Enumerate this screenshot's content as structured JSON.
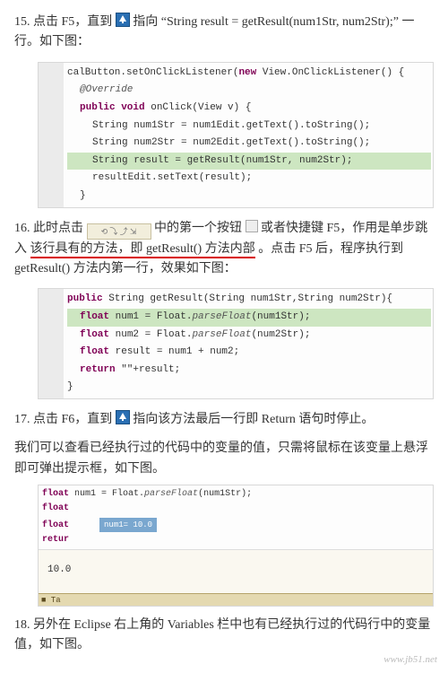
{
  "items": {
    "s15": {
      "num": "15.",
      "pre": "点击 F5，直到",
      "post": "指向 “String result = getResult(num1Str, num2Str);” 一行。如下图："
    },
    "code1": {
      "l1a": "calButton.setOnClickListener(",
      "l1b": "new",
      "l1c": " View.OnClickListener() {",
      "l2": "@Override",
      "l3a": "public void",
      "l3b": " onClick(View v) {",
      "l4": "String num1Str = num1Edit.getText().toString();",
      "l5": "String num2Str = num2Edit.getText().toString();",
      "l6": "String result = getResult(num1Str, num2Str);",
      "l7": "resultEdit.setText(result);",
      "l8": "}"
    },
    "s16": {
      "num": "16.",
      "pre": "此时点击",
      "mid1": "中的第一个按钮",
      "mid2": "或者快捷键 F5，作用是单步跳入",
      "red": "该行具有的方法，即 getResult() 方法内部",
      "post": "。点击 F5 后，程序执行到 getResult() 方法内第一行，效果如下图："
    },
    "code2": {
      "l1a": "public",
      "l1b": " String getResult(String num1Str,String num2Str){",
      "l2a": "float",
      "l2b": " num1 = Float.",
      "l2c": "parseFloat",
      "l2d": "(num1Str);",
      "l3a": "float",
      "l3b": " num2 = Float.",
      "l3c": "parseFloat",
      "l3d": "(num2Str);",
      "l4a": "float",
      "l4b": " result = num1 + num2;",
      "l5a": "return",
      "l5b": " \"\"+result;",
      "l6": "}"
    },
    "s17": {
      "num": "17.",
      "pre": "点击 F6，直到",
      "post": "指向该方法最后一行即 Return 语句时停止。"
    },
    "p17b": "我们可以查看已经执行过的代码中的变量的值，只需将鼠标在该变量上悬浮即可弹出提示框，如下图。",
    "fig3": {
      "codeA": "float num1 = Float.parseFloat(num1Str);",
      "codeB": "float",
      "codeC": "float",
      "codeD": "retur",
      "badge": "num1= 10.0",
      "val": "10.0",
      "status": "■ Ta"
    },
    "s18": {
      "num": "18.",
      "text": "另外在 Eclipse 右上角的 Variables 栏中也有已经执行过的代码行中的变量值，如下图。"
    }
  },
  "watermark": "www.jb51.net"
}
